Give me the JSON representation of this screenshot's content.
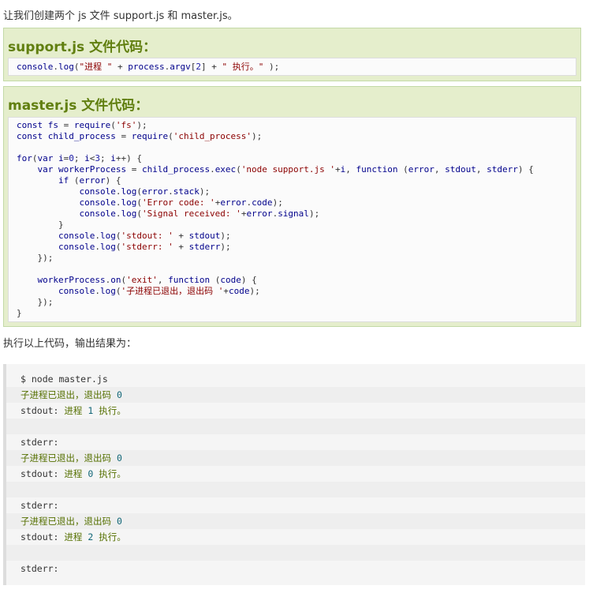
{
  "intro": "让我们创建两个 js 文件 support.js 和 master.js。",
  "support_example": {
    "title": "support.js 文件代码：",
    "code": "console.log(\"进程 \" + process.argv[2] + \" 执行。\" );"
  },
  "master_example": {
    "title": "master.js 文件代码：",
    "code_lines": [
      "const fs = require('fs');",
      "const child_process = require('child_process');",
      "",
      "for(var i=0; i<3; i++) {",
      "    var workerProcess = child_process.exec('node support.js '+i, function (error, stdout, stderr) {",
      "        if (error) {",
      "            console.log(error.stack);",
      "            console.log('Error code: '+error.code);",
      "            console.log('Signal received: '+error.signal);",
      "        }",
      "        console.log('stdout: ' + stdout);",
      "        console.log('stderr: ' + stderr);",
      "    });",
      "",
      "    workerProcess.on('exit', function (code) {",
      "        console.log('子进程已退出，退出码 '+code);",
      "    });",
      "}"
    ]
  },
  "mid_text": "执行以上代码，输出结果为：",
  "output_lines": [
    "$ node master.js",
    "子进程已退出，退出码 0",
    "stdout: 进程 1 执行。",
    "",
    "stderr:",
    "子进程已退出，退出码 0",
    "stdout: 进程 0 执行。",
    "",
    "stderr:",
    "子进程已退出，退出码 0",
    "stdout: 进程 2 执行。",
    "",
    "stderr:"
  ],
  "colors": {
    "example_bg": "#e5eecc",
    "title_green": "#617f10",
    "keyword_blue": "#00008b",
    "string_red": "#8b0000"
  }
}
